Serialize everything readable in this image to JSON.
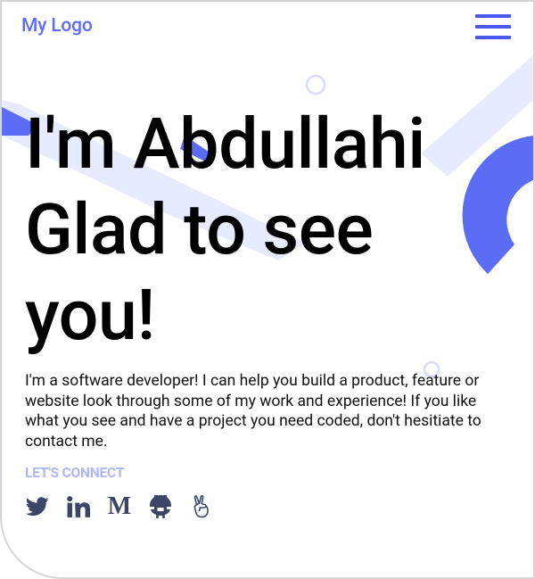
{
  "header": {
    "logo_text": "My Logo",
    "menu_icon": "hamburger-menu-icon"
  },
  "hero": {
    "title_lines": [
      "I'm Abdullahi",
      "Glad to see",
      "you!"
    ],
    "intro": "I'm a software developer! I can help you build a product, feature or website look through some of my work and experience! If you like what you see and have a project you need coded, don't hesitiate to contact me."
  },
  "connect": {
    "label": "LET'S CONNECT",
    "links": [
      {
        "name": "twitter",
        "icon": "twitter-icon"
      },
      {
        "name": "linkedin",
        "icon": "linkedin-icon"
      },
      {
        "name": "medium",
        "icon": "medium-icon",
        "glyph": "M"
      },
      {
        "name": "github",
        "icon": "github-icon"
      },
      {
        "name": "angellist",
        "icon": "angellist-icon"
      }
    ]
  },
  "colors": {
    "accent": "#5b6cf7",
    "accent_light": "#e8eaff",
    "connect_label": "#aeb7fa",
    "icon": "#3c4566"
  }
}
